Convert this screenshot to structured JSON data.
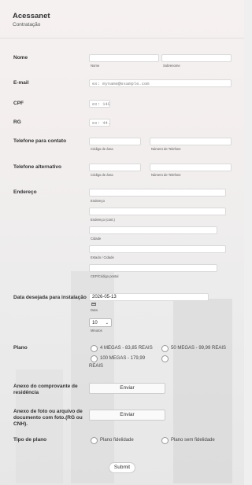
{
  "header": {
    "title": "Acessanet",
    "subtitle": "Contratação"
  },
  "fields": {
    "nome": {
      "label": "Nome",
      "first_sub": "Nome",
      "last_sub": "Sobrenome"
    },
    "email": {
      "label": "E-mail",
      "placeholder": "ex: myname@example.com"
    },
    "cpf": {
      "label": "CPF",
      "placeholder": "ex: 149"
    },
    "rg": {
      "label": "RG",
      "placeholder": "ex: 44."
    },
    "telefone": {
      "label": "Telefone para contato",
      "area_sub": "Código de área",
      "number_sub": "Número de Telefone"
    },
    "telefone_alt": {
      "label": "Telefone alternativo",
      "area_sub": "Código de área",
      "number_sub": "Número de Telefone"
    },
    "endereco": {
      "label": "Endereço",
      "line1_sub": "Endereço",
      "line2_sub": "Endereço (cont.)",
      "city_sub": "Cidade",
      "state_sub": "Estado / Cidade",
      "zip_sub": "CEP/Código postal"
    },
    "data": {
      "label": "Data desejada para instalação",
      "value": "2026-05-13",
      "date_sub": "Data",
      "minutes_value": "10",
      "minutes_sub": "Minutos"
    },
    "plano": {
      "label": "Plano",
      "options": [
        "4 MEGAS - 83,85 REAIS",
        "50 MEGAS - 99,99 REAIS",
        "100 MEGAS - 179,99",
        "REAIS"
      ]
    },
    "anexo_comprovante": {
      "label": "Anexo do comprovante de residência",
      "button": "Enviar"
    },
    "anexo_foto": {
      "label": "Anexo de foto ou arquivo de documento com foto.(RG ou CNH).",
      "button": "Enviar"
    },
    "tipo_plano": {
      "label": "Tipo de plano",
      "options": [
        "Plano fidelidade",
        "Plano sem fidelidade"
      ]
    }
  },
  "submit_label": "Submit"
}
